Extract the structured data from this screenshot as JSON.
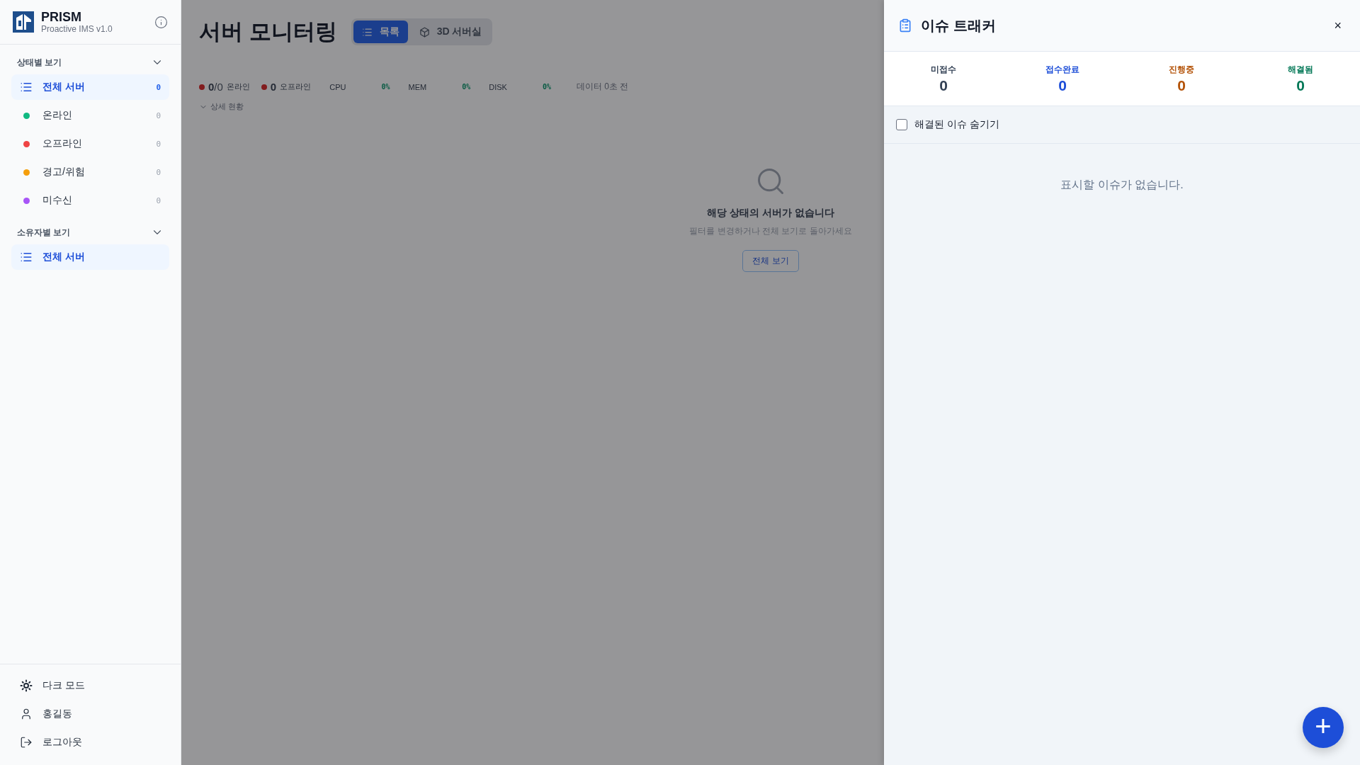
{
  "sidebar": {
    "brand": {
      "name": "PRISM",
      "subtitle": "Proactive IMS v1.0"
    },
    "sections": [
      {
        "title": "상태별 보기",
        "expanded": true,
        "items": [
          {
            "kind": "all",
            "label": "전체 서버",
            "count": "0",
            "selected": true
          },
          {
            "kind": "status",
            "label": "온라인",
            "count": "0",
            "selected": false,
            "color": "#10b981"
          },
          {
            "kind": "status",
            "label": "오프라인",
            "count": "0",
            "selected": false,
            "color": "#ef4444"
          },
          {
            "kind": "status",
            "label": "경고/위험",
            "count": "0",
            "selected": false,
            "color": "#f59e0b"
          },
          {
            "kind": "status",
            "label": "미수신",
            "count": "0",
            "selected": false,
            "color": "#a855f7"
          }
        ]
      },
      {
        "title": "소유자별 보기",
        "expanded": true,
        "items": [
          {
            "kind": "all",
            "label": "전체 서버",
            "selected": true
          }
        ]
      }
    ],
    "footer": [
      {
        "kind": "theme",
        "label": "다크 모드"
      },
      {
        "kind": "user",
        "label": "홍길동"
      },
      {
        "kind": "logout",
        "label": "로그아웃"
      }
    ]
  },
  "main": {
    "title": "서버 모니터링",
    "view_tabs": [
      {
        "kind": "list",
        "label": "목록",
        "selected": true
      },
      {
        "kind": "cube",
        "label": "3D 서버실",
        "selected": false
      }
    ],
    "summary": {
      "counts": [
        {
          "value": "0",
          "total": "/0",
          "label": "온라인"
        },
        {
          "value": "0",
          "label": "오프라인"
        }
      ],
      "metrics": [
        {
          "label": "CPU",
          "value": "0%"
        },
        {
          "label": "MEM",
          "value": "0%"
        },
        {
          "label": "DISK",
          "value": "0%"
        }
      ],
      "updated": "데이터 0초 전"
    },
    "detail_toggle": {
      "label": "상세 현황"
    },
    "empty": {
      "title": "해당 상태의 서버가 없습니다",
      "hint": "필터를 변경하거나 전체 보기로 돌아가세요",
      "button": "전체 보기"
    }
  },
  "issue_panel": {
    "title": "이슈 트래커",
    "close": "×",
    "stats": [
      {
        "label": "미접수",
        "value": "0",
        "color": "#334155"
      },
      {
        "label": "접수완료",
        "value": "0",
        "color": "#1d4ed8"
      },
      {
        "label": "진행중",
        "value": "0",
        "color": "#b45309"
      },
      {
        "label": "해결됨",
        "value": "0",
        "color": "#047857"
      }
    ],
    "filter": {
      "label": "해결된 이슈 숨기기",
      "checked": false
    },
    "empty": "표시할 이슈가 없습니다.",
    "add_button": "+"
  }
}
